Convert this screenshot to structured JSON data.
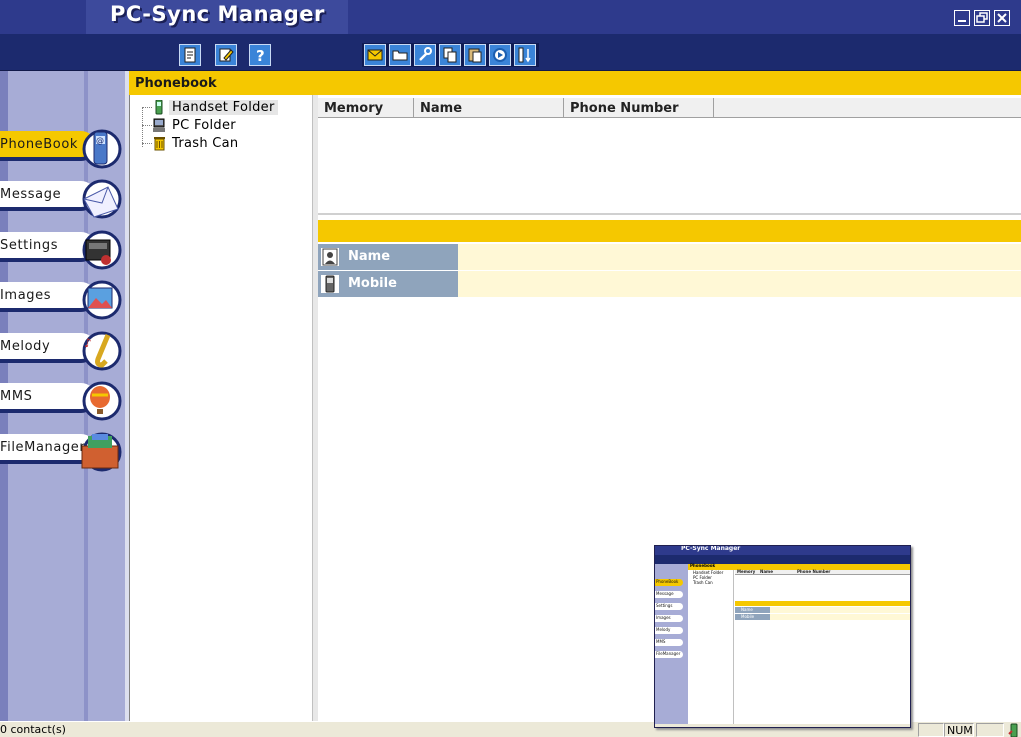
{
  "app": {
    "title": "PC-Sync Manager"
  },
  "colors": {
    "titlebar": "#2e3a8c",
    "toolbar": "#1c2a6e",
    "accent": "#f5c800",
    "nav": "#a7acd6",
    "field_label": "#8fa4bc",
    "field_value": "#fff8d6"
  },
  "toolbar": {
    "left_buttons": [
      "document-icon",
      "edit-icon",
      "help-icon"
    ],
    "right_buttons": [
      "envelope-icon",
      "folder-open-icon",
      "wrench-icon",
      "copy-icon",
      "paste-icon",
      "sync-icon",
      "sort-icon"
    ]
  },
  "nav": {
    "items": [
      {
        "label": "PhoneBook",
        "icon": "phone-icon",
        "active": true
      },
      {
        "label": "Message",
        "icon": "envelope-icon",
        "active": false
      },
      {
        "label": "Settings",
        "icon": "settings-device-icon",
        "active": false
      },
      {
        "label": "Images",
        "icon": "image-icon",
        "active": false
      },
      {
        "label": "Melody",
        "icon": "saxophone-icon",
        "active": false
      },
      {
        "label": "MMS",
        "icon": "balloon-icon",
        "active": false
      },
      {
        "label": "FileManager",
        "icon": "file-cabinet-icon",
        "active": false
      }
    ]
  },
  "section": {
    "title": "Phonebook"
  },
  "tree": {
    "items": [
      {
        "label": "Handset Folder",
        "icon": "handset-icon",
        "selected": true
      },
      {
        "label": "PC Folder",
        "icon": "pc-icon",
        "selected": false
      },
      {
        "label": "Trash Can",
        "icon": "trash-icon",
        "selected": false
      }
    ]
  },
  "list": {
    "columns": [
      "Memory",
      "Name",
      "Phone Number"
    ],
    "rows": []
  },
  "detail": {
    "fields": [
      {
        "label": "Name",
        "icon": "person-icon",
        "value": ""
      },
      {
        "label": "Mobile",
        "icon": "mobile-icon",
        "value": ""
      }
    ]
  },
  "status": {
    "text": "0 contact(s)",
    "num": "NUM"
  },
  "thumbnail": {
    "title": "PC-Sync Manager",
    "header": "Phonebook",
    "tree": [
      "Handset Folder",
      "PC Folder",
      "Trash Can"
    ],
    "columns": [
      "Memory",
      "Name",
      "Phone Number"
    ],
    "fields": [
      "Name",
      "Mobile"
    ],
    "tabs": [
      "PhoneBook",
      "Message",
      "Settings",
      "Images",
      "Melody",
      "MMS",
      "FileManager"
    ]
  }
}
